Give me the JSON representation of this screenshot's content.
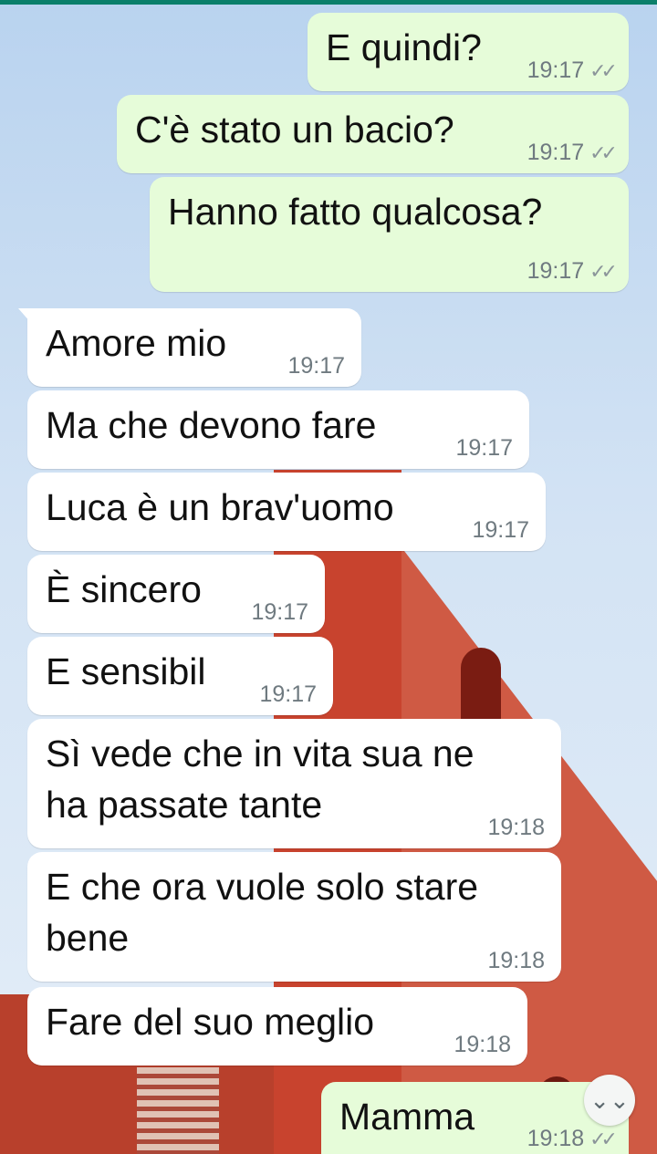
{
  "messages": [
    {
      "text": "E quindi?",
      "time": "19:17",
      "dir": "out"
    },
    {
      "text": "C'è stato un bacio?",
      "time": "19:17",
      "dir": "out"
    },
    {
      "text": "Hanno fatto qualcosa?",
      "time": "19:17",
      "dir": "out"
    },
    {
      "text": "Amore mio",
      "time": "19:17",
      "dir": "in"
    },
    {
      "text": "Ma che devono fare",
      "time": "19:17",
      "dir": "in"
    },
    {
      "text": "Luca è un brav'uomo",
      "time": "19:17",
      "dir": "in"
    },
    {
      "text": "È sincero",
      "time": "19:17",
      "dir": "in"
    },
    {
      "text": "E sensibil",
      "time": "19:17",
      "dir": "in"
    },
    {
      "text": "Sì vede che in vita sua ne ha passate tante",
      "time": "19:18",
      "dir": "in"
    },
    {
      "text": "E che ora vuole solo stare bene",
      "time": "19:18",
      "dir": "in"
    },
    {
      "text": "Fare del suo meglio",
      "time": "19:18",
      "dir": "in"
    },
    {
      "text": "Mamma",
      "time": "19:18",
      "dir": "out"
    }
  ],
  "status": {
    "read_icon": "double-check-icon"
  },
  "scroll_button": {
    "icon": "double-chevron-down-icon",
    "glyph": "⌄⌄"
  },
  "colors": {
    "outgoing": "#e6fcd9",
    "incoming": "#ffffff",
    "topbar": "#0b7f6a"
  }
}
